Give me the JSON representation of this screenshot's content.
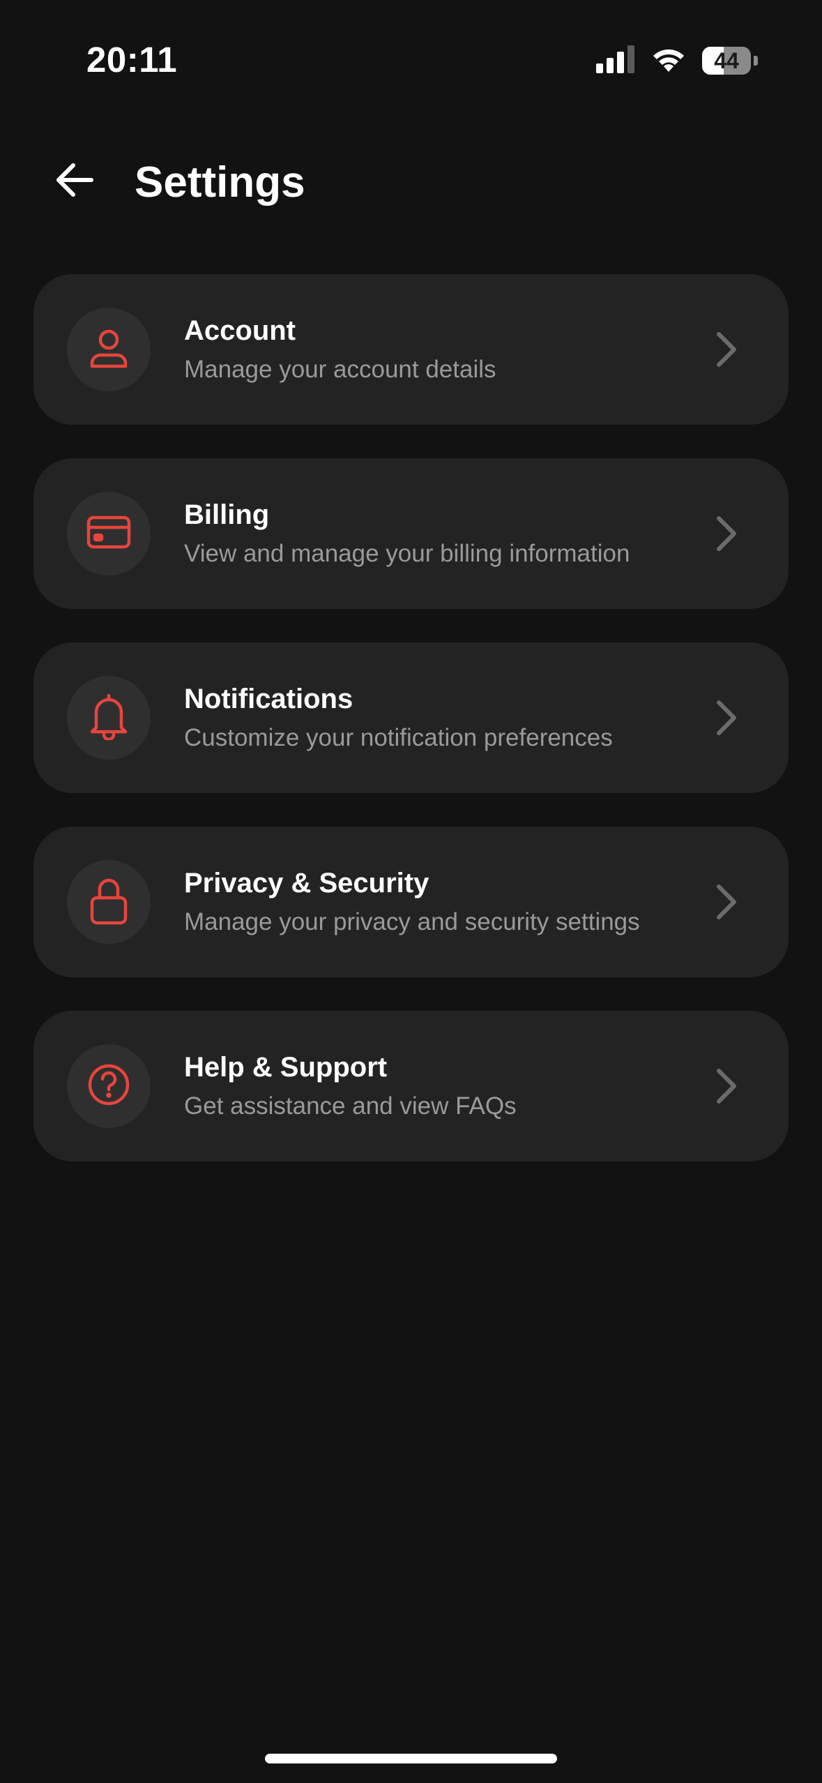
{
  "status_bar": {
    "time": "20:11",
    "battery_percent": "44",
    "battery_level": 0.44
  },
  "header": {
    "title": "Settings",
    "back_icon": "arrow-left-icon"
  },
  "colors": {
    "background": "#121212",
    "card": "#232323",
    "icon_circle": "#2f2f2f",
    "accent": "#e8453c",
    "subtitle": "#9a9a9a",
    "chevron": "#6b6b6b"
  },
  "settings": {
    "items": [
      {
        "title": "Account",
        "subtitle": "Manage your account details",
        "icon": "user-icon"
      },
      {
        "title": "Billing",
        "subtitle": "View and manage your billing information",
        "icon": "credit-card-icon"
      },
      {
        "title": "Notifications",
        "subtitle": "Customize your notification preferences",
        "icon": "bell-icon"
      },
      {
        "title": "Privacy & Security",
        "subtitle": "Manage your privacy and security settings",
        "icon": "lock-icon"
      },
      {
        "title": "Help & Support",
        "subtitle": "Get assistance and view FAQs",
        "icon": "help-circle-icon"
      }
    ]
  }
}
